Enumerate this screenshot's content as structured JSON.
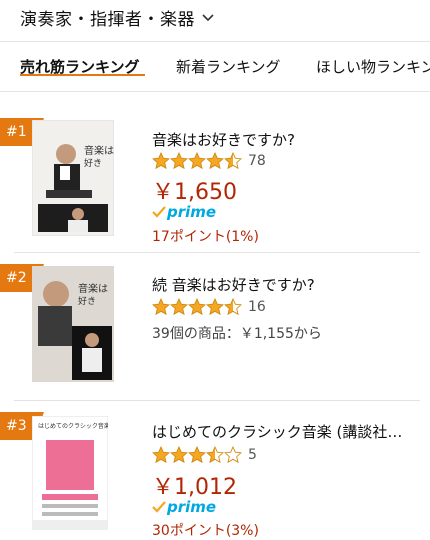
{
  "header": {
    "title": "演奏家・指揮者・楽器"
  },
  "tabs": [
    {
      "label": "売れ筋ランキング"
    },
    {
      "label": "新着ランキング"
    },
    {
      "label": "ほしい物ランキング"
    }
  ],
  "colors": {
    "accent": "#e47911",
    "price": "#b12704",
    "prime": "#00a8e1",
    "star": "#f5a623"
  },
  "items": [
    {
      "rank": "#1",
      "title": "音楽はお好きですか?",
      "rating": 4.5,
      "review_count": "78",
      "price": "￥1,650",
      "prime_label": "prime",
      "points": "17ポイント(1%)"
    },
    {
      "rank": "#2",
      "title": "続 音楽はお好きですか?",
      "rating": 4.5,
      "review_count": "16",
      "offers": "39個の商品：￥1,155から"
    },
    {
      "rank": "#3",
      "title": "はじめてのクラシック音楽 (講談社…",
      "rating": 3.5,
      "review_count": "5",
      "price": "￥1,012",
      "prime_label": "prime",
      "points": "30ポイント(3%)"
    }
  ]
}
